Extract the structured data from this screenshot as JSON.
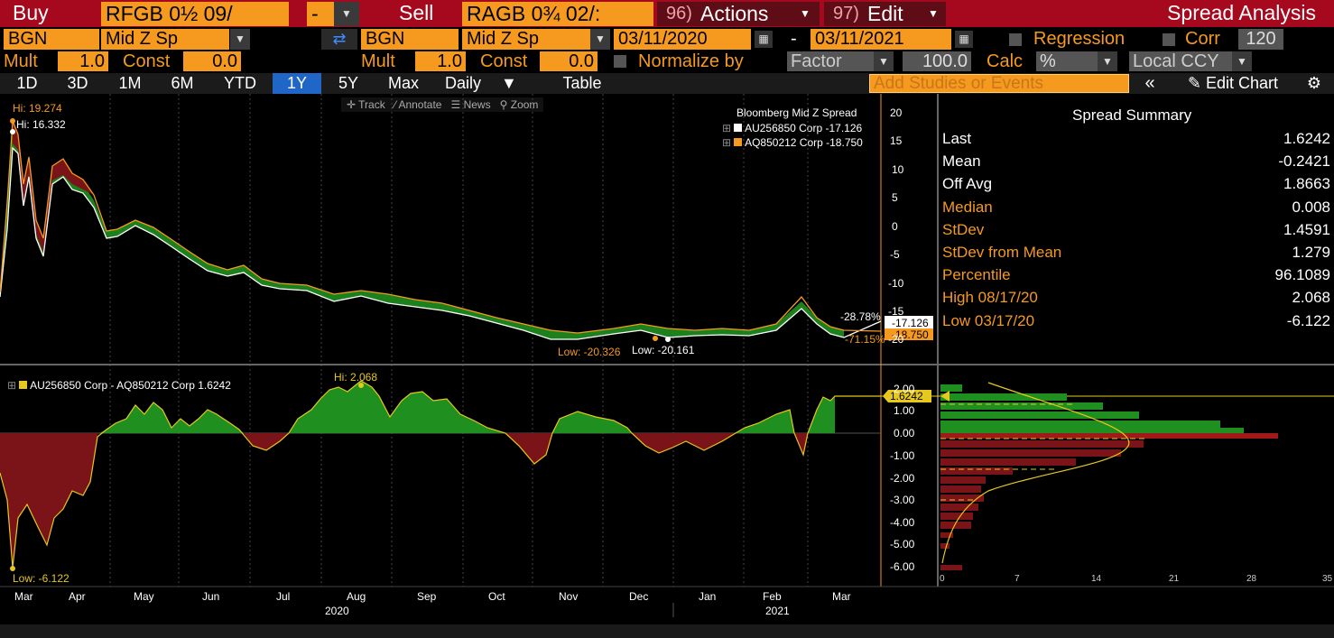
{
  "header": {
    "buy_label": "Buy",
    "buy_ticker": "RFGB 0½ 09/",
    "buy_ticker_sup": "",
    "minus_field": "-",
    "sell_label": "Sell",
    "sell_ticker": "RAGB 0¾ 02/:",
    "actions_num": "96)",
    "actions_label": "Actions",
    "edit_num": "97)",
    "edit_label": "Edit",
    "title": "Spread Analysis"
  },
  "row2": {
    "source1": "BGN",
    "field1": "Mid Z Sp",
    "source2": "BGN",
    "field2": "Mid Z Sp",
    "start_date": "03/11/2020",
    "dash": "-",
    "end_date": "03/11/2021",
    "regression_label": "Regression",
    "corr_label": "Corr",
    "corr_value": "120"
  },
  "row3": {
    "mult_label": "Mult",
    "mult1": "1.0",
    "const_label": "Const",
    "const1": "0.0",
    "mult2": "1.0",
    "const2": "0.0",
    "normalize_label": "Normalize by",
    "normalize_value": "Factor",
    "normalize_num": "100.0",
    "calc_label": "Calc",
    "calc_value": "%",
    "ccy_value": "Local CCY"
  },
  "tabs": {
    "ranges": [
      "1D",
      "3D",
      "1M",
      "6M",
      "YTD",
      "1Y",
      "5Y",
      "Max"
    ],
    "active": "1Y",
    "frequency": "Daily",
    "table_label": "Table",
    "studies_placeholder": "Add Studies or Events",
    "edit_chart_label": "Edit Chart"
  },
  "toolbar": {
    "track": "Track",
    "annotate": "Annotate",
    "news": "News",
    "zoom": "Zoom"
  },
  "legend": {
    "title": "Bloomberg Mid Z Spread",
    "s1": "AU256850 Corp -17.126",
    "s2": "AQ850212 Corp -18.750"
  },
  "lower_legend": "AU256850 Corp - AQ850212 Corp 1.6242",
  "annotations": {
    "upper_hi_orange": "Hi: 19.274",
    "upper_hi_white": "Hi: 16.332",
    "upper_low_orange": "Low: -20.326",
    "upper_low_white": "Low: -20.161",
    "val_2878": "-28.78%",
    "val_7115": "-71.15%",
    "last_white": "-17.126",
    "last_orange": "-18.750",
    "lower_hi": "Hi: 2.068",
    "lower_low": "Low: -6.122",
    "lower_last": "1.6242"
  },
  "summary": {
    "title": "Spread Summary",
    "rows": [
      {
        "label": "Last",
        "value": "1.6242",
        "color": "#ffffff"
      },
      {
        "label": "Mean",
        "value": "-0.2421",
        "color": "#ffffff"
      },
      {
        "label": "Off Avg",
        "value": "1.8663",
        "color": "#ffffff"
      },
      {
        "label": "Median",
        "value": "0.008",
        "color": "#f59a1e"
      },
      {
        "label": "StDev",
        "value": "1.4591",
        "color": "#f59a1e"
      },
      {
        "label": "StDev from Mean",
        "value": "1.279",
        "color": "#f59a1e"
      },
      {
        "label": "Percentile",
        "value": "96.1089",
        "color": "#f59a1e"
      },
      {
        "label": "High 08/17/20",
        "value": "2.068",
        "color": "#f59a1e"
      },
      {
        "label": "Low 03/17/20",
        "value": "-6.122",
        "color": "#f59a1e"
      }
    ]
  },
  "axes": {
    "upper_ticks": [
      "20",
      "15",
      "10",
      "5",
      "0",
      "-5",
      "-10",
      "-15",
      "-20"
    ],
    "lower_ticks": [
      "2.00",
      "1.00",
      "0.00",
      "-1.00",
      "-2.00",
      "-3.00",
      "-4.00",
      "-5.00",
      "-6.00"
    ],
    "months": [
      "Mar",
      "Apr",
      "May",
      "Jun",
      "Jul",
      "Aug",
      "Sep",
      "Oct",
      "Nov",
      "Dec",
      "Jan",
      "Feb",
      "Mar"
    ],
    "year1": "2020",
    "year2": "2021",
    "hist_ticks": [
      "0",
      "7",
      "14",
      "21",
      "28",
      "35"
    ]
  },
  "colors": {
    "header_red": "#a6081d",
    "orange": "#f59a1e",
    "green": "#1f8f1f",
    "maroon": "#7a1418",
    "active_tab": "#1f66c6"
  },
  "chart_data": [
    {
      "type": "line",
      "title": "Bloomberg Mid Z Spread",
      "x": [
        "2020-03",
        "2020-04",
        "2020-05",
        "2020-06",
        "2020-07",
        "2020-08",
        "2020-09",
        "2020-10",
        "2020-11",
        "2020-12",
        "2021-01",
        "2021-02",
        "2021-03"
      ],
      "series": [
        {
          "name": "AU256850 Corp",
          "values": [
            16.3,
            4,
            -2,
            -6,
            -10,
            -12,
            -13,
            -16,
            -17,
            -19,
            -18,
            -14,
            -17.126
          ]
        },
        {
          "name": "AQ850212 Corp",
          "values": [
            19.3,
            6,
            -2,
            -7,
            -11,
            -12,
            -14,
            -16,
            -18,
            -19,
            -18,
            -13,
            -18.75
          ]
        }
      ],
      "ylim": [
        -22,
        22
      ]
    },
    {
      "type": "area",
      "title": "AU256850 Corp - AQ850212 Corp",
      "x": [
        "2020-03",
        "2020-04",
        "2020-05",
        "2020-06",
        "2020-07",
        "2020-08",
        "2020-09",
        "2020-10",
        "2020-11",
        "2020-12",
        "2021-01",
        "2021-02",
        "2021-03"
      ],
      "values": [
        -6.1,
        -1.2,
        0.8,
        -0.1,
        -0.4,
        1.8,
        1.0,
        0.3,
        -0.9,
        -0.6,
        -0.1,
        0.7,
        1.6242
      ],
      "ylim": [
        -6.5,
        2.5
      ]
    },
    {
      "type": "bar",
      "title": "Distribution",
      "categories": [
        "1.5",
        "1.0",
        "0.5",
        "0.0",
        "-0.5",
        "-1.0",
        "-1.5",
        "-2.0",
        "-2.5",
        "-3.0",
        "-3.5",
        "-4.0",
        "-4.5",
        "-5.0",
        "-5.5",
        "-6.0"
      ],
      "values": [
        8,
        16,
        22,
        30,
        18,
        15,
        10,
        6,
        5,
        4,
        3,
        3,
        1,
        1,
        1,
        2
      ],
      "xlim": [
        0,
        35
      ]
    }
  ]
}
